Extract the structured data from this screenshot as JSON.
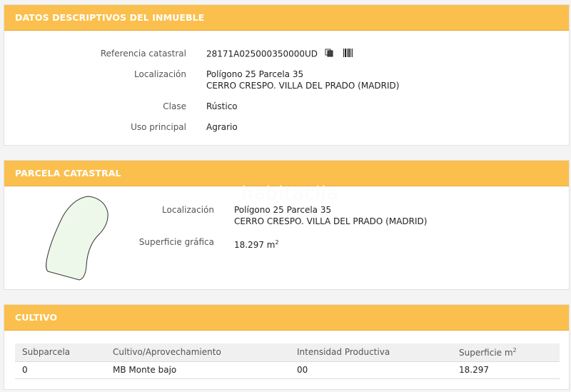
{
  "panel1": {
    "title": "DATOS DESCRIPTIVOS DEL INMUEBLE",
    "ref_label": "Referencia catastral",
    "ref_value": "28171A025000350000UD",
    "loc_label": "Localización",
    "loc_line1": "Polígono 25 Parcela 35",
    "loc_line2": "CERRO CRESPO. VILLA DEL PRADO (MADRID)",
    "clase_label": "Clase",
    "clase_value": "Rústico",
    "uso_label": "Uso principal",
    "uso_value": "Agrario"
  },
  "panel2": {
    "title": "PARCELA CATASTRAL",
    "loc_label": "Localización",
    "loc_line1": "Polígono 25 Parcela 35",
    "loc_line2": "CERRO CRESPO. VILLA DEL PRADO (MADRID)",
    "sup_label": "Superficie gráfica",
    "sup_value": "18.297 m",
    "sup_unit_exp": "2"
  },
  "watermark": "habitaclia",
  "panel3": {
    "title": "CULTIVO",
    "headers": {
      "subparcela": "Subparcela",
      "cultivo": "Cultivo/Aprovechamiento",
      "intensidad": "Intensidad Productiva",
      "superficie": "Superficie m",
      "superficie_exp": "2"
    },
    "rows": [
      {
        "subparcela": "0",
        "cultivo": "MB Monte bajo",
        "intensidad": "00",
        "superficie": "18.297"
      }
    ]
  },
  "icons": {
    "copy": "copy-icon",
    "barcode": "barcode-icon"
  },
  "colors": {
    "header_bg": "#fbbf4d",
    "parcel_fill": "#eef8ea"
  }
}
